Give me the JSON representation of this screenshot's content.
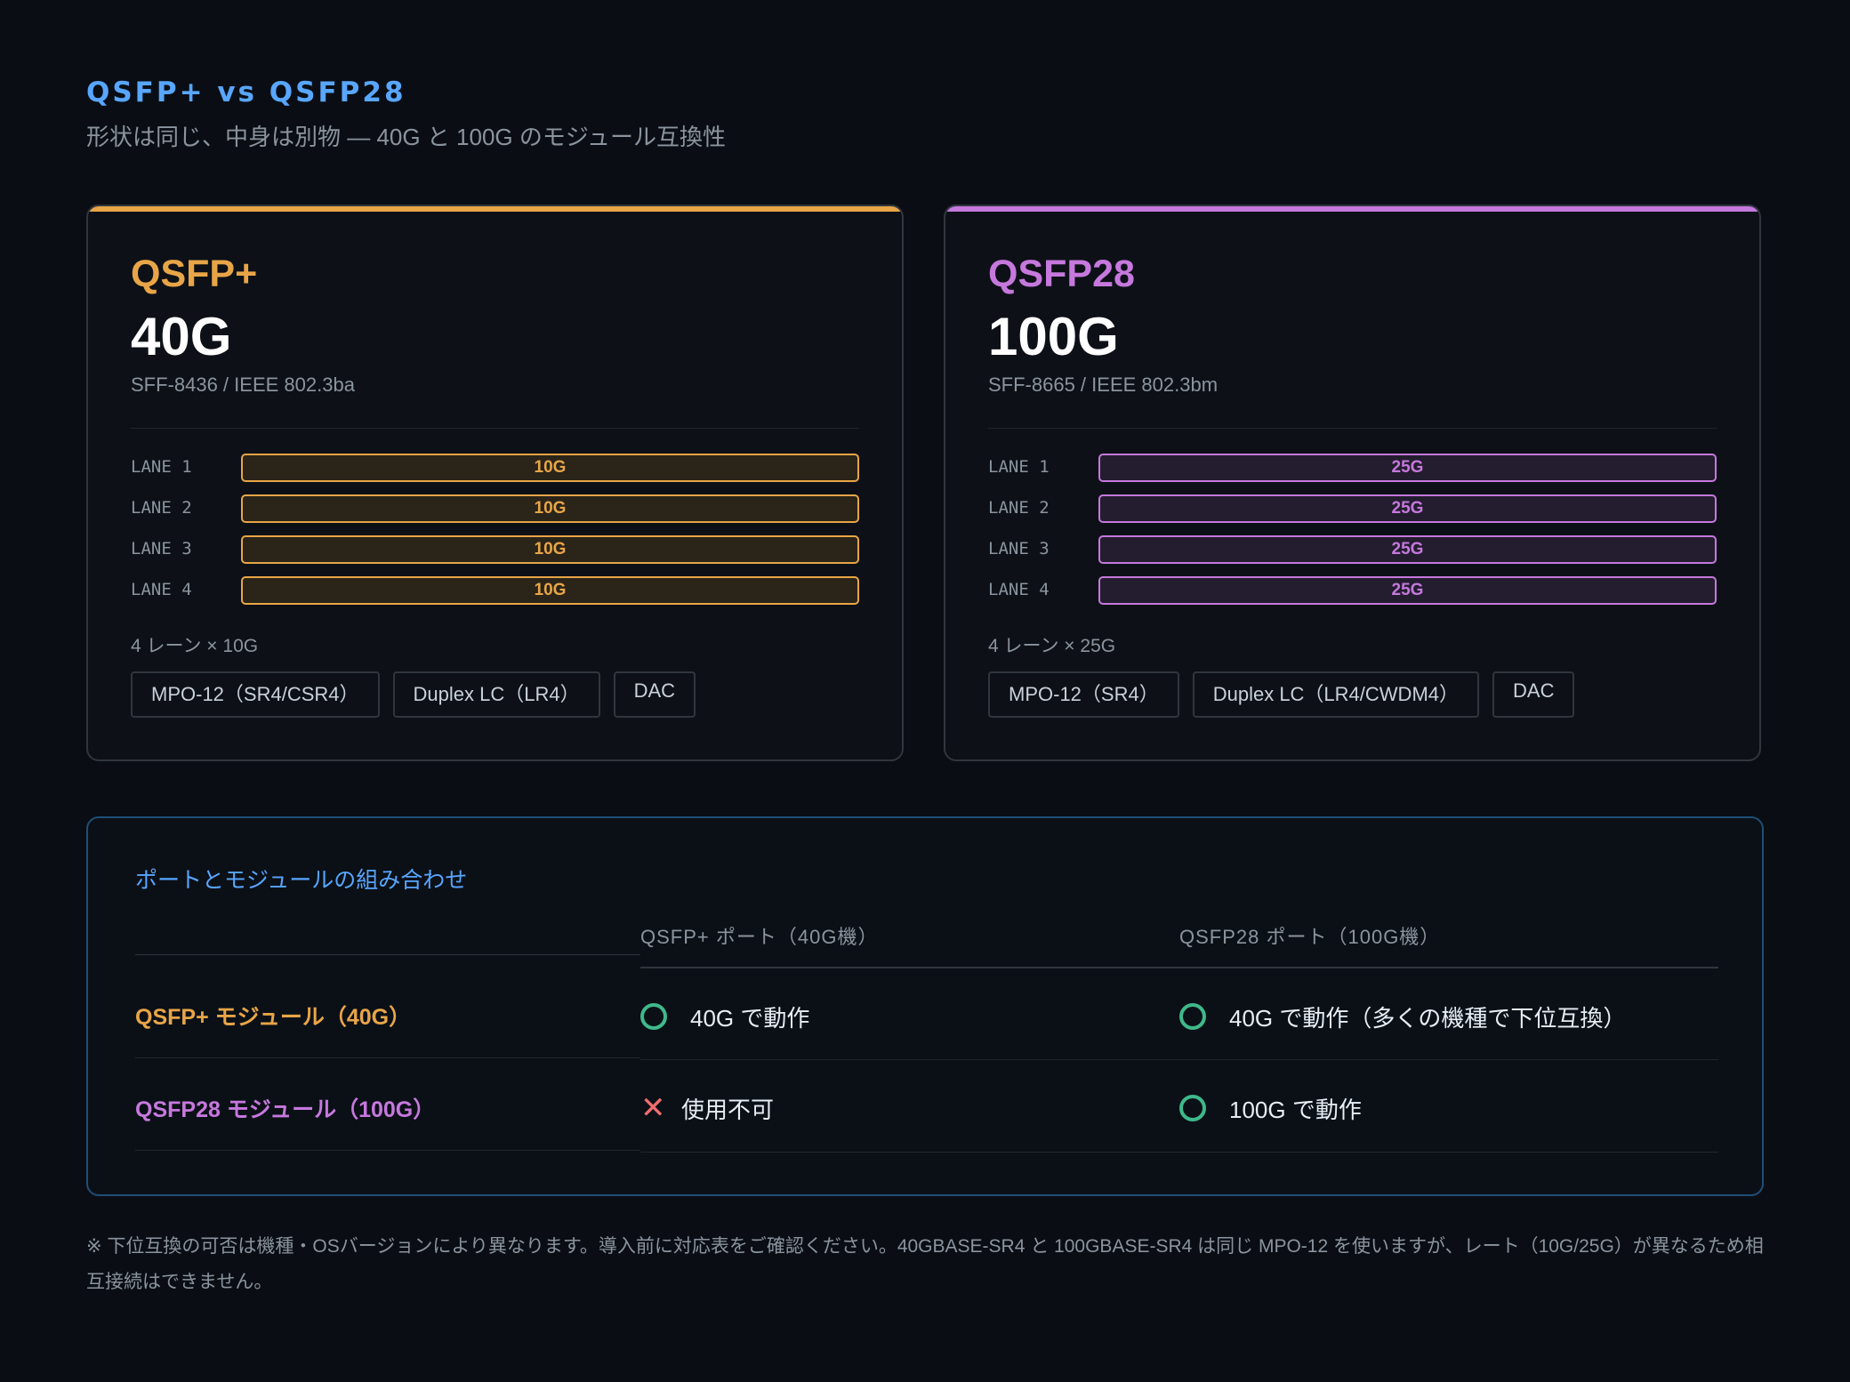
{
  "header": {
    "title": "QSFP+ vs QSFP28",
    "subtitle": "形状は同じ、中身は別物 — 40G と 100G のモジュール互換性"
  },
  "cards": [
    {
      "name": "QSFP+",
      "speed": "40G",
      "standard": "SFF-8436 / IEEE 802.3ba",
      "lanes": [
        {
          "label": "LANE 1",
          "rate": "10G"
        },
        {
          "label": "LANE 2",
          "rate": "10G"
        },
        {
          "label": "LANE 3",
          "rate": "10G"
        },
        {
          "label": "LANE 4",
          "rate": "10G"
        }
      ],
      "lane_summary": "4 レーン × 10G",
      "connectors": [
        "MPO-12（SR4/CSR4）",
        "Duplex LC（LR4）",
        "DAC"
      ],
      "accent": "#e8a547"
    },
    {
      "name": "QSFP28",
      "speed": "100G",
      "standard": "SFF-8665 / IEEE 802.3bm",
      "lanes": [
        {
          "label": "LANE 1",
          "rate": "25G"
        },
        {
          "label": "LANE 2",
          "rate": "25G"
        },
        {
          "label": "LANE 3",
          "rate": "25G"
        },
        {
          "label": "LANE 4",
          "rate": "25G"
        }
      ],
      "lane_summary": "4 レーン × 25G",
      "connectors": [
        "MPO-12（SR4）",
        "Duplex LC（LR4/CWDM4）",
        "DAC"
      ],
      "accent": "#c678dd"
    }
  ],
  "compat": {
    "title": "ポートとモジュールの組み合わせ",
    "columns": [
      "QSFP+ ポート（40G機）",
      "QSFP28 ポート（100G機）"
    ],
    "rows": [
      {
        "label": "QSFP+ モジュール（40G）",
        "cells": [
          {
            "icon": "ok-circle-icon",
            "text": "40G で動作"
          },
          {
            "icon": "ok-circle-icon",
            "text": "40G で動作（多くの機種で下位互換）"
          }
        ]
      },
      {
        "label": "QSFP28 モジュール（100G）",
        "cells": [
          {
            "icon": "ng-cross-icon",
            "text": "使用不可"
          },
          {
            "icon": "ok-circle-icon",
            "text": "100G で動作"
          }
        ]
      }
    ]
  },
  "footnote": "※ 下位互換の可否は機種・OSバージョンにより異なります。導入前に対応表をご確認ください。40GBASE-SR4 と 100GBASE-SR4 は同じ MPO-12 を使いますが、レート（10G/25G）が異なるため相互接続はできません。",
  "colors": {
    "background": "#0a0e14",
    "qsfp_plus": "#e8a547",
    "qsfp28": "#c678dd",
    "ok": "#3fb98a",
    "ng": "#f06d6d",
    "title_blue": "#58a6ff"
  }
}
